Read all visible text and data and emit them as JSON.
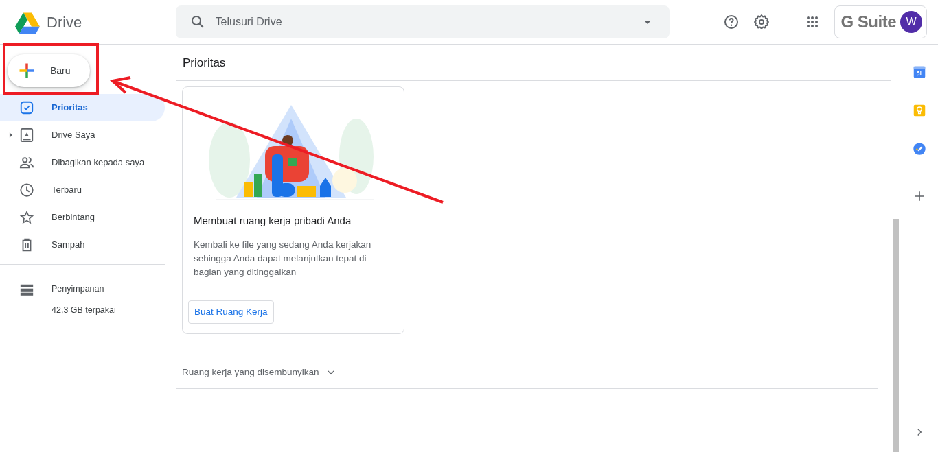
{
  "app": {
    "name": "Drive"
  },
  "search": {
    "placeholder": "Telusuri Drive"
  },
  "account": {
    "brand": "G Suite",
    "avatar_initial": "W"
  },
  "new_button": {
    "label": "Baru"
  },
  "sidebar": {
    "items": [
      {
        "kind": "priority",
        "label": "Prioritas",
        "selected": true,
        "expandable": false
      },
      {
        "kind": "my_drive",
        "label": "Drive Saya",
        "selected": false,
        "expandable": true
      },
      {
        "kind": "shared",
        "label": "Dibagikan kepada saya",
        "selected": false,
        "expandable": false
      },
      {
        "kind": "recent",
        "label": "Terbaru",
        "selected": false,
        "expandable": false
      },
      {
        "kind": "starred",
        "label": "Berbintang",
        "selected": false,
        "expandable": false
      },
      {
        "kind": "trash",
        "label": "Sampah",
        "selected": false,
        "expandable": false
      }
    ]
  },
  "storage": {
    "label": "Penyimpanan",
    "usage": "42,3 GB terpakai"
  },
  "main": {
    "title": "Prioritas",
    "card": {
      "title": "Membuat ruang kerja pribadi Anda",
      "description": "Kembali ke file yang sedang Anda kerjakan sehingga Anda dapat melanjutkan tepat di bagian yang ditinggalkan",
      "button": "Buat Ruang Kerja"
    },
    "hidden_section": {
      "label": "Ruang kerja yang disembunyikan",
      "expanded": false
    }
  }
}
